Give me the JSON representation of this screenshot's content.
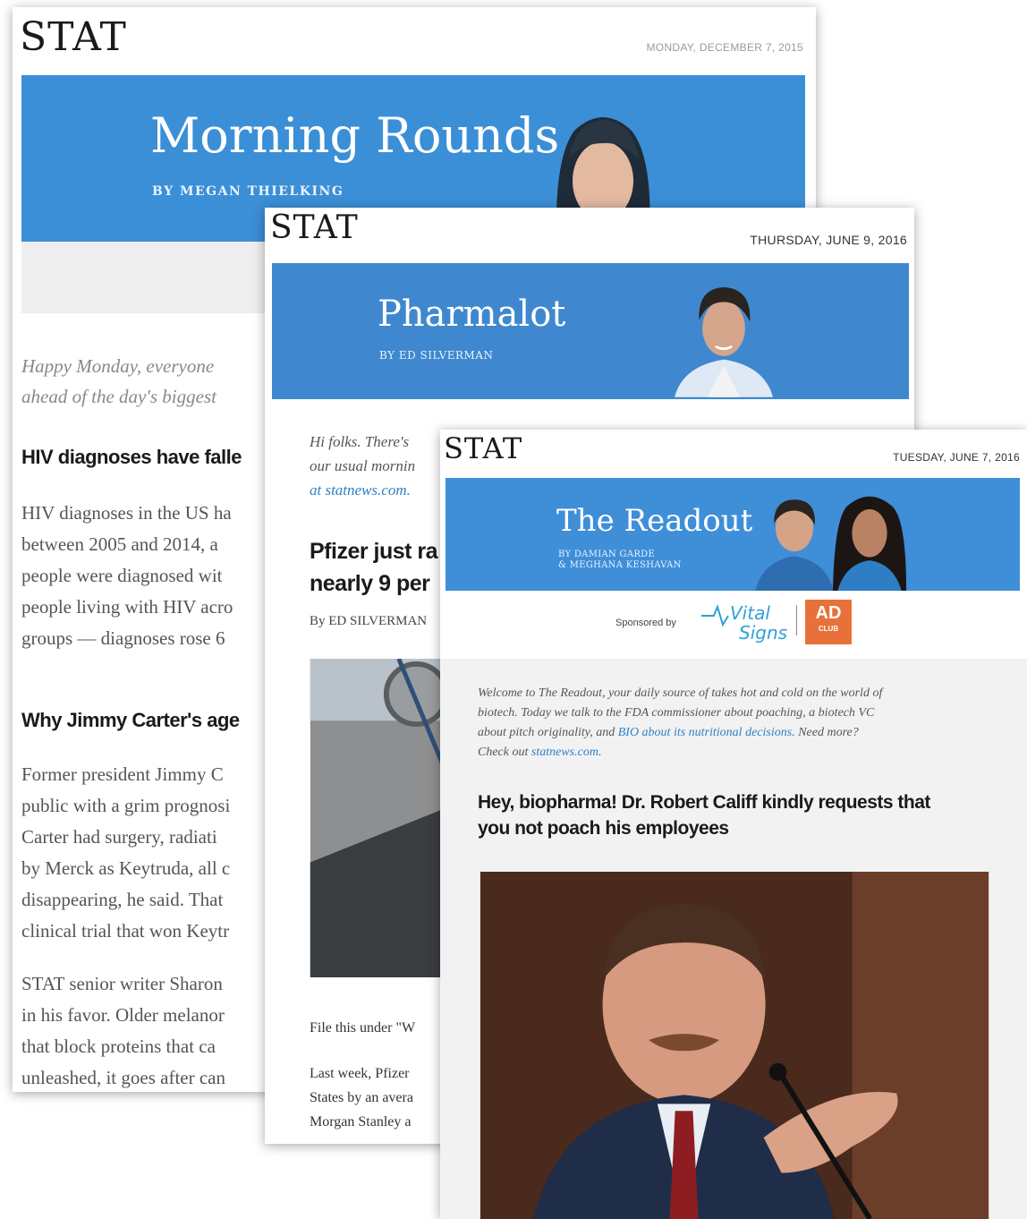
{
  "card1": {
    "logo": "STAT",
    "date": "MONDAY, DECEMBER 7, 2015",
    "banner_title": "Morning Rounds",
    "byline": "By MEGAN THIELKING",
    "intro_lines": [
      "Happy Monday, everyone",
      "ahead of the day's biggest"
    ],
    "headline1": "HIV diagnoses have falle",
    "para1": [
      "HIV diagnoses in the US ha",
      "between 2005 and 2014, a",
      "people were diagnosed wit",
      "people living with HIV acro",
      "groups — diagnoses rose 6"
    ],
    "headline2": "Why Jimmy Carter's age",
    "para2": [
      "Former president Jimmy C",
      "public with a grim prognosi",
      "Carter had surgery, radiati",
      "by Merck as Keytruda, all c",
      "disappearing, he said. That",
      "clinical trial that won Keytr"
    ],
    "para3": [
      "STAT senior writer Sharon",
      "in his favor. Older melanor",
      "that block proteins that ca",
      "unleashed, it goes after can"
    ]
  },
  "card2": {
    "logo": "STAT",
    "date": "THURSDAY, JUNE 9, 2016",
    "banner_title": "Pharmalot",
    "byline": "By ED SILVERMAN",
    "intro_lines": [
      "Hi folks. There's",
      "our usual mornin",
      "at statnews.com."
    ],
    "headline": [
      "Pfizer just ra",
      "nearly 9 per"
    ],
    "author": "By  ED SILVERMAN",
    "file_under": "File this under \"W",
    "para": [
      "Last week, Pfizer",
      "States by an avera",
      "Morgan Stanley a"
    ]
  },
  "card3": {
    "logo": "STAT",
    "date": "TUESDAY, JUNE 7, 2016",
    "banner_title": "The Readout",
    "byline1": "By DAMIAN GARDE",
    "byline2": "& MEGHANA KESHAVAN",
    "sponsored_by": "Sponsored by",
    "sponsor_name": "Vital Signs",
    "adclub_top": "AD",
    "adclub_bottom": "CLUB",
    "intro": {
      "l1": "Welcome to The Readout, your daily source of takes hot and cold on the world of",
      "l2": "biotech. Today we talk to the FDA commissioner about poaching, a biotech VC",
      "l3a": "about pitch originality, and ",
      "l3link": "BIO about its nutritional decisions",
      "l3b": ". Need more?",
      "l4a": "Check out ",
      "l4link": "statnews.com",
      "l4b": "."
    },
    "headline": [
      "Hey, biopharma! Dr. Robert Califf kindly requests that",
      "you not poach his employees"
    ]
  }
}
